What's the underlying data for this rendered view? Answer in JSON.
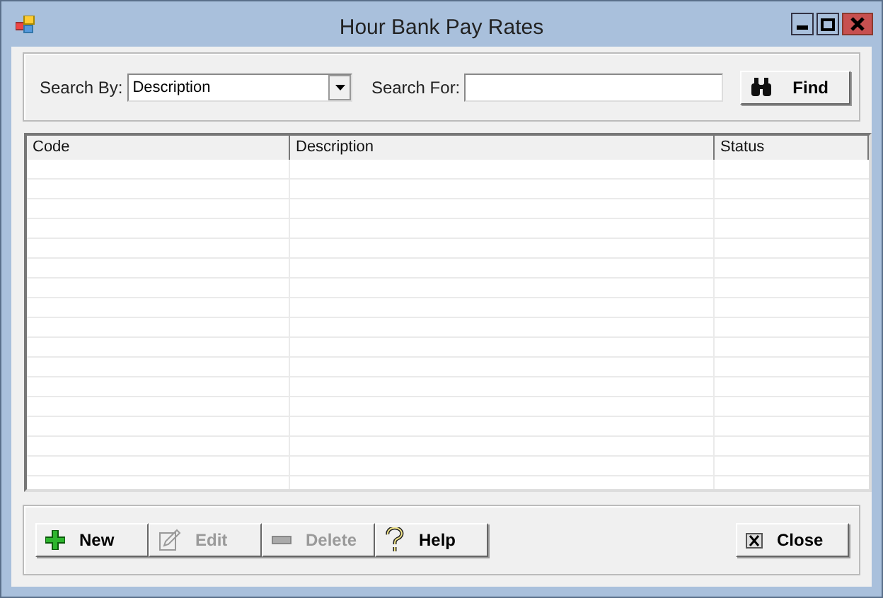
{
  "window": {
    "title": "Hour Bank Pay Rates"
  },
  "search": {
    "by_label": "Search By:",
    "by_value": "Description",
    "for_label": "Search For:",
    "find_button": "Find"
  },
  "table": {
    "columns": [
      "Code",
      "Description",
      "Status"
    ]
  },
  "buttons": [
    {
      "kind": "new",
      "label": "New",
      "disabled": false
    },
    {
      "kind": "edit",
      "label": "Edit",
      "disabled": true
    },
    {
      "kind": "delete",
      "label": "Delete",
      "disabled": true
    },
    {
      "kind": "help",
      "label": "Help",
      "disabled": false
    }
  ],
  "close_button": "Close"
}
